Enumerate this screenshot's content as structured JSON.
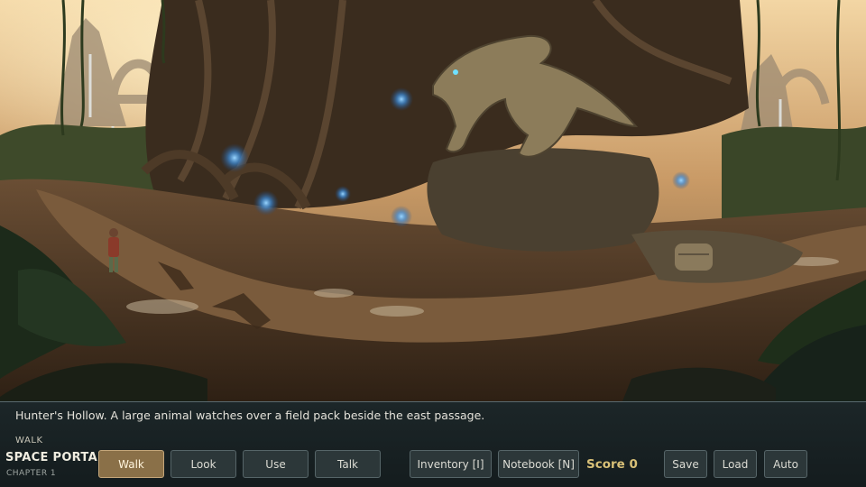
{
  "scene": {
    "location_description": "Hunter's Hollow. A large animal watches over a field pack beside the east passage."
  },
  "hud": {
    "current_verb": "WALK",
    "game_title": "SPACE PORTAL",
    "chapter": "CHAPTER 1",
    "verbs": {
      "walk": "Walk",
      "look": "Look",
      "use": "Use",
      "talk": "Talk"
    },
    "active_verb": "walk",
    "inventory_label": "Inventory [I]",
    "notebook_label": "Notebook [N]",
    "score_text": "Score 0",
    "save_label": "Save",
    "load_label": "Load",
    "auto_label": "Auto"
  },
  "colors": {
    "active_button": "#8a7048",
    "score": "#d8c077",
    "crystal_glow": "#5fb4ff"
  }
}
